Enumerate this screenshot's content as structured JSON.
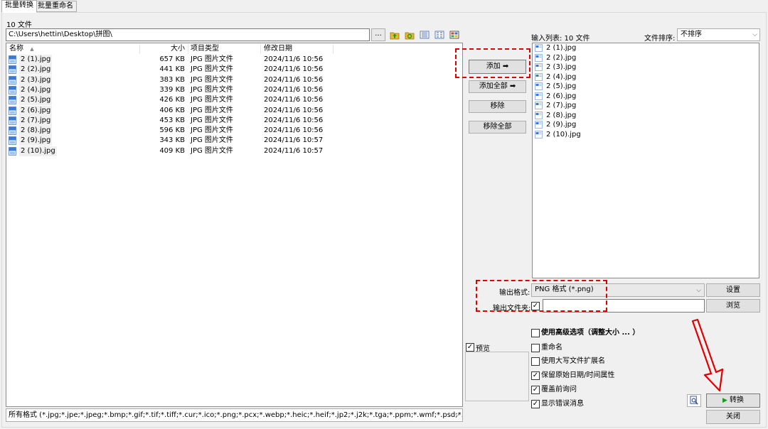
{
  "tabs": [
    {
      "label": "批量转换",
      "active": true
    },
    {
      "label": "批量重命名",
      "active": false
    }
  ],
  "file_count_label": "10 文件",
  "path": {
    "value": "C:\\Users\\hettin\\Desktop\\拼图\\",
    "browse_label": "..."
  },
  "toolbar_icons": [
    "folder-up-icon",
    "refresh-folder-icon",
    "view-list-icon",
    "view-details-icon",
    "view-thumbnails-icon"
  ],
  "columns": {
    "name": "名称",
    "size": "大小",
    "type": "项目类型",
    "date": "修改日期",
    "sort_indicator": "▲"
  },
  "files": [
    {
      "name": "2 (1).jpg",
      "size": "657 KB",
      "type": "JPG 图片文件",
      "date": "2024/11/6 10:56"
    },
    {
      "name": "2 (2).jpg",
      "size": "441 KB",
      "type": "JPG 图片文件",
      "date": "2024/11/6 10:56"
    },
    {
      "name": "2 (3).jpg",
      "size": "383 KB",
      "type": "JPG 图片文件",
      "date": "2024/11/6 10:56"
    },
    {
      "name": "2 (4).jpg",
      "size": "339 KB",
      "type": "JPG 图片文件",
      "date": "2024/11/6 10:56"
    },
    {
      "name": "2 (5).jpg",
      "size": "426 KB",
      "type": "JPG 图片文件",
      "date": "2024/11/6 10:56"
    },
    {
      "name": "2 (6).jpg",
      "size": "406 KB",
      "type": "JPG 图片文件",
      "date": "2024/11/6 10:56"
    },
    {
      "name": "2 (7).jpg",
      "size": "453 KB",
      "type": "JPG 图片文件",
      "date": "2024/11/6 10:56"
    },
    {
      "name": "2 (8).jpg",
      "size": "596 KB",
      "type": "JPG 图片文件",
      "date": "2024/11/6 10:56"
    },
    {
      "name": "2 (9).jpg",
      "size": "343 KB",
      "type": "JPG 图片文件",
      "date": "2024/11/6 10:57"
    },
    {
      "name": "2 (10).jpg",
      "size": "409 KB",
      "type": "JPG 图片文件",
      "date": "2024/11/6 10:57"
    }
  ],
  "filter": {
    "value": "所有格式 (*.jpg;*.jpe;*.jpeg;*.bmp;*.gif;*.tif;*.tiff;*.cur;*.ico;*.png;*.pcx;*.webp;*.heic;*.heif;*.jp2;*.j2k;*.tga;*.ppm;*.wmf;*.psd;*.eps)"
  },
  "actions": {
    "add": "添加 ➡",
    "add_all": "添加全部 ➡",
    "remove": "移除",
    "remove_all": "移除全部"
  },
  "input_list": {
    "label": "输入列表: 10 文件",
    "sort_label": "文件排序:",
    "sort_value": "不排序",
    "items": [
      "2 (1).jpg",
      "2 (2).jpg",
      "2 (3).jpg",
      "2 (4).jpg",
      "2 (5).jpg",
      "2 (6).jpg",
      "2 (7).jpg",
      "2 (8).jpg",
      "2 (9).jpg",
      "2 (10).jpg"
    ]
  },
  "output": {
    "format_label": "输出格式:",
    "format_value": "PNG 格式 (*.png)",
    "settings_label": "设置",
    "folder_label": "输出文件夹:",
    "folder_checked": true,
    "folder_value": "",
    "browse_label": "浏览"
  },
  "preview": {
    "label": "预览",
    "checked": true
  },
  "options": [
    {
      "label": "使用高级选项（调整大小 ... ）",
      "checked": false,
      "bold": true
    },
    {
      "label": "重命名",
      "checked": false
    },
    {
      "label": "使用大写文件扩展名",
      "checked": false
    },
    {
      "label": "保留原始日期/时间属性",
      "checked": true
    },
    {
      "label": "覆盖前询问",
      "checked": true
    },
    {
      "label": "显示错误消息",
      "checked": true
    }
  ],
  "bottom_buttons": {
    "convert": "转换",
    "close": "关闭"
  },
  "colors": {
    "annotation_red": "#e00000",
    "convert_icon_green": "#1a9a1a"
  }
}
